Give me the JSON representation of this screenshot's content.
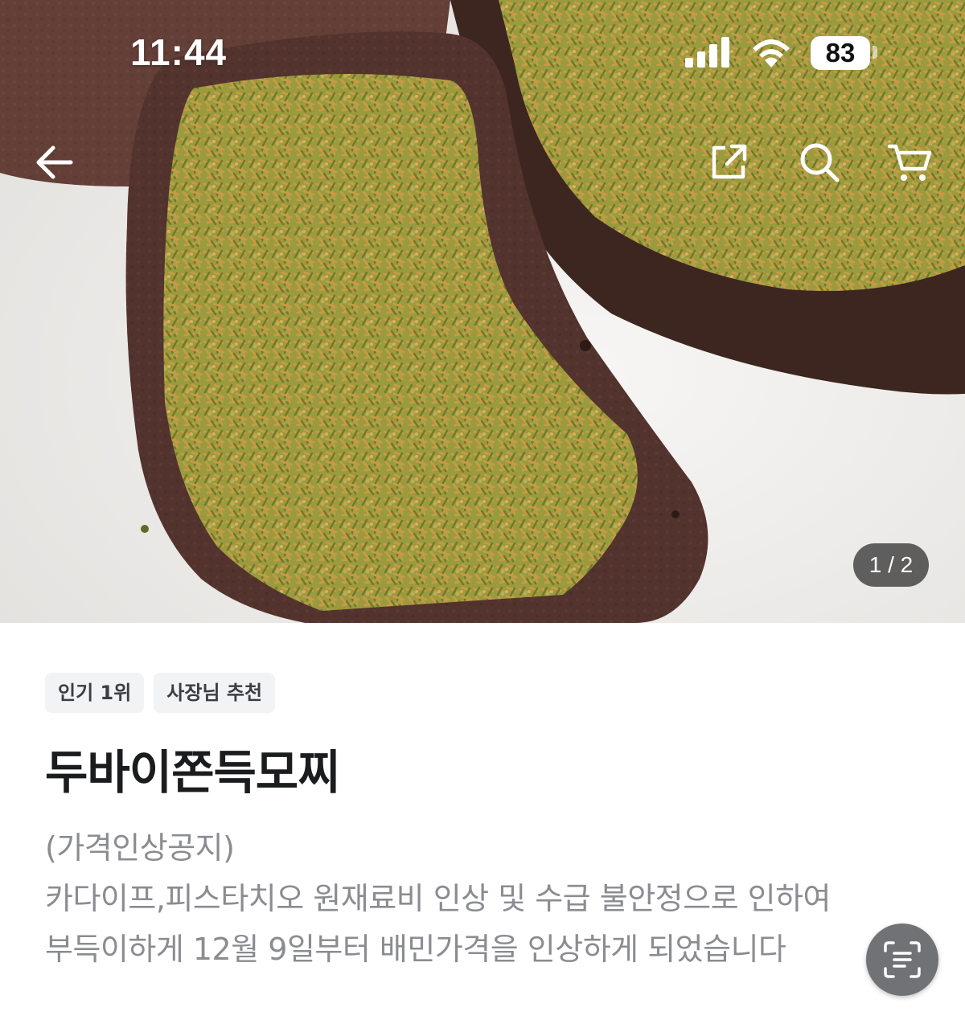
{
  "status_bar": {
    "time": "11:44",
    "battery": "83",
    "icons": [
      "cellular-signal-icon",
      "wifi-icon",
      "battery-icon"
    ]
  },
  "header": {
    "back_icon": "arrow-left-icon",
    "share_icon": "share-icon",
    "search_icon": "search-icon",
    "cart_icon": "cart-icon"
  },
  "gallery": {
    "pager": "1 / 2"
  },
  "product": {
    "badges": [
      "인기 1위",
      "사장님 추천"
    ],
    "name": "두바이쫀득모찌",
    "description": [
      "(가격인상공지)",
      "카다이프,피스타치오 원재료비 인상 및 수급 불안정으로 인하여",
      " 부득이하게 12월 9일부터 배민가격을 인상하게 되었습니다"
    ]
  },
  "floating": {
    "scan_icon": "text-scan-icon"
  },
  "colors": {
    "title": "#1b1c1e",
    "description": "#8a8c91",
    "badge_bg": "#f2f3f5",
    "pager_bg": "#282828"
  }
}
